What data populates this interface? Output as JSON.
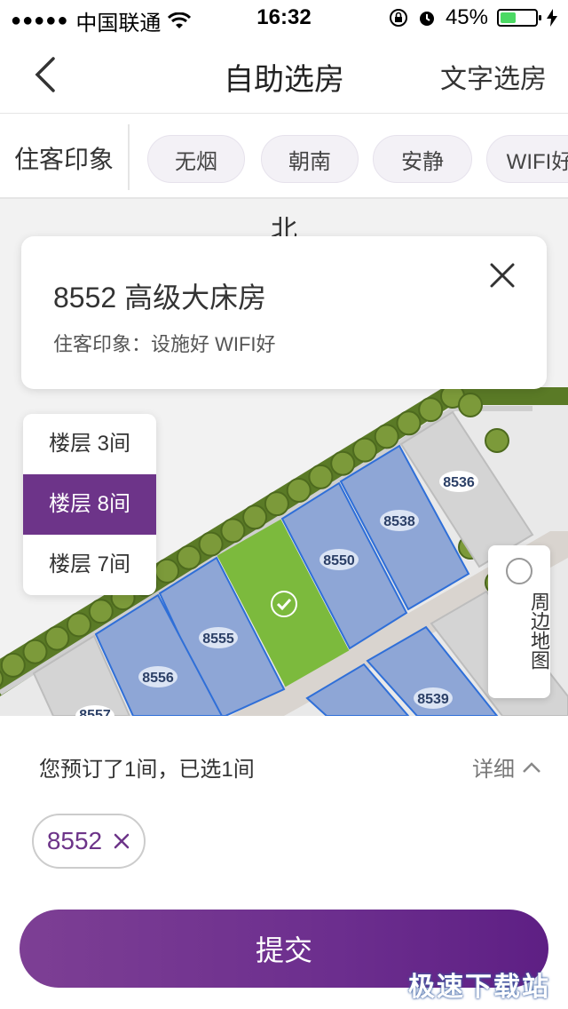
{
  "status_bar": {
    "carrier": "中国联通",
    "time": "16:32",
    "battery_percent": "45%",
    "battery_level": 0.45
  },
  "nav": {
    "title": "自助选房",
    "right_link": "文字选房"
  },
  "tags": {
    "label": "住客印象",
    "items": [
      "无烟",
      "朝南",
      "安静",
      "WIFI好"
    ]
  },
  "map": {
    "north_label": "北",
    "rooms": [
      {
        "number": "8536",
        "state": "unavailable"
      },
      {
        "number": "8538",
        "state": "available"
      },
      {
        "number": "8550",
        "state": "available"
      },
      {
        "number": "8552",
        "state": "selected"
      },
      {
        "number": "8555",
        "state": "available"
      },
      {
        "number": "8556",
        "state": "available"
      },
      {
        "number": "8557",
        "state": "unavailable"
      },
      {
        "number": "8539",
        "state": "available"
      }
    ],
    "colors": {
      "available": "#8ea6d6",
      "selected": "#7cba3d",
      "unavailable": "#d4d4d4",
      "hedge": "#5a7a26"
    }
  },
  "room_card": {
    "title": "8552 高级大床房",
    "impression": "住客印象：设施好 WIFI好"
  },
  "floors": [
    {
      "label": "楼层  3间",
      "active": false
    },
    {
      "label": "楼层  8间",
      "active": true
    },
    {
      "label": "楼层  7间",
      "active": false
    }
  ],
  "around_map": {
    "label": "周边地图"
  },
  "bottom": {
    "booked_info": "您预订了1间，已选1间",
    "detail_label": "详细",
    "selected_room": "8552",
    "submit_label": "提交"
  },
  "watermark": "极速下载站",
  "theme": {
    "accent": "#6d3489"
  }
}
